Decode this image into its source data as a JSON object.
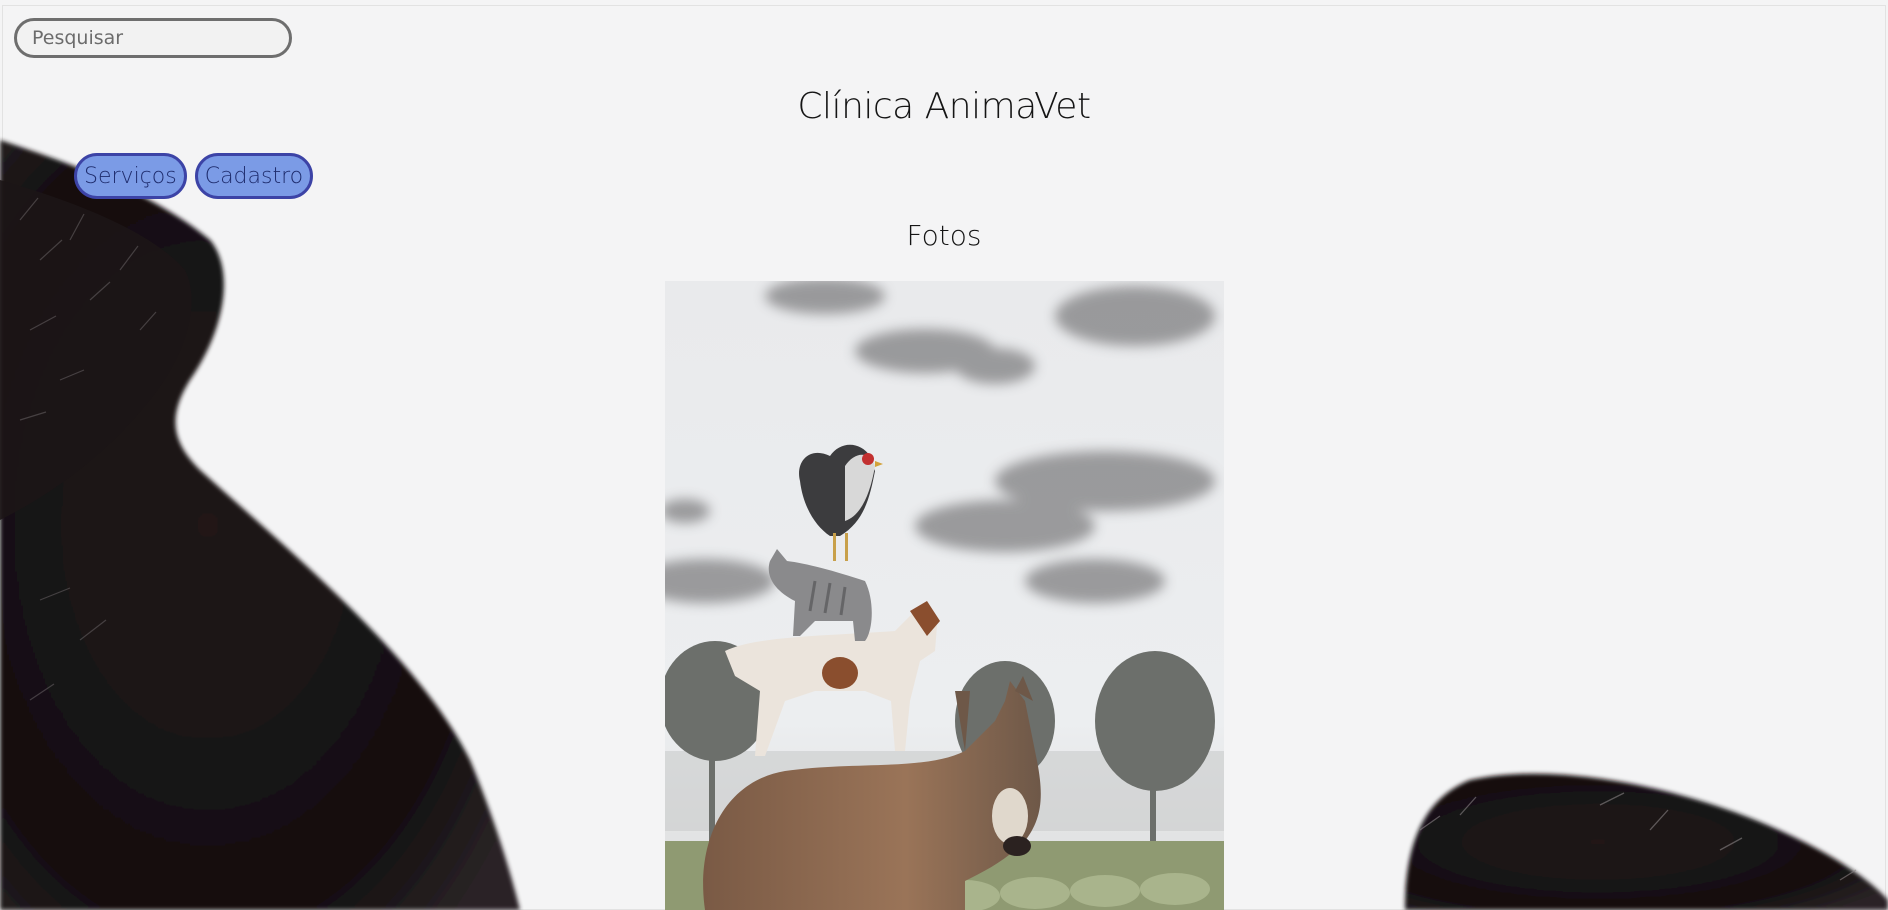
{
  "search": {
    "placeholder": "Pesquisar"
  },
  "header": {
    "title": "Clínica AnimaVet"
  },
  "nav": {
    "items": [
      {
        "label": "Serviços"
      },
      {
        "label": "Cadastro"
      }
    ]
  },
  "gallery": {
    "heading": "Fotos"
  },
  "colors": {
    "button_fill": "#7b9be6",
    "button_border": "#3c43a6",
    "page_background": "#f4f4f5"
  },
  "icons": {
    "background": "black-animal-ears-photo",
    "main_photo": "stacked-farm-animals-photo"
  }
}
